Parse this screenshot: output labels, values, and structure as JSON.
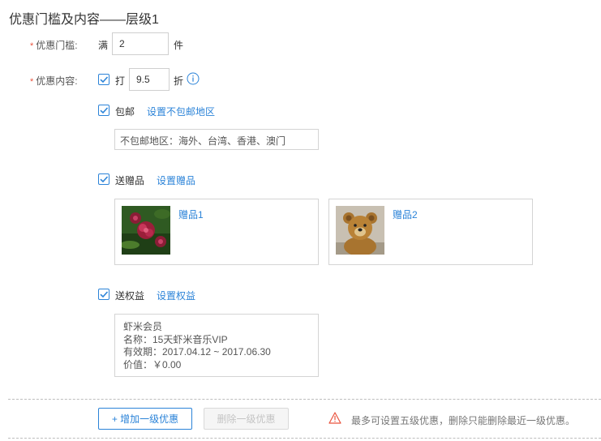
{
  "title": "优惠门槛及内容——层级1",
  "required_mark": "*",
  "threshold": {
    "label": "优惠门槛:",
    "prefix": "满",
    "value": "2",
    "unit": "件"
  },
  "content": {
    "label": "优惠内容:",
    "discount": {
      "checked": true,
      "prefix": "打",
      "value": "9.5",
      "unit": "折"
    },
    "shipping": {
      "checked": true,
      "label": "包邮",
      "link": "设置不包邮地区",
      "excluded_regions": "不包邮地区：海外、台湾、香港、澳门"
    },
    "gifts": {
      "checked": true,
      "label": "送赠品",
      "link": "设置赠品",
      "items": [
        {
          "name": "赠品1",
          "image": "red-flower-photo"
        },
        {
          "name": "赠品2",
          "image": "teddy-bear-photo"
        }
      ]
    },
    "benefits": {
      "checked": true,
      "label": "送权益",
      "link": "设置权益",
      "lines": [
        "虾米会员",
        "名称：15天虾米音乐VIP",
        "有效期：2017.04.12 ~ 2017.06.30",
        "价值：￥0.00"
      ]
    }
  },
  "footer": {
    "add_button": "+ 增加一级优惠",
    "delete_button": "删除一级优惠",
    "warning": "最多可设置五级优惠，删除只能删除最近一级优惠。"
  },
  "colors": {
    "accent": "#2b83d8",
    "required": "#e9533e",
    "warning": "#e9533e"
  }
}
